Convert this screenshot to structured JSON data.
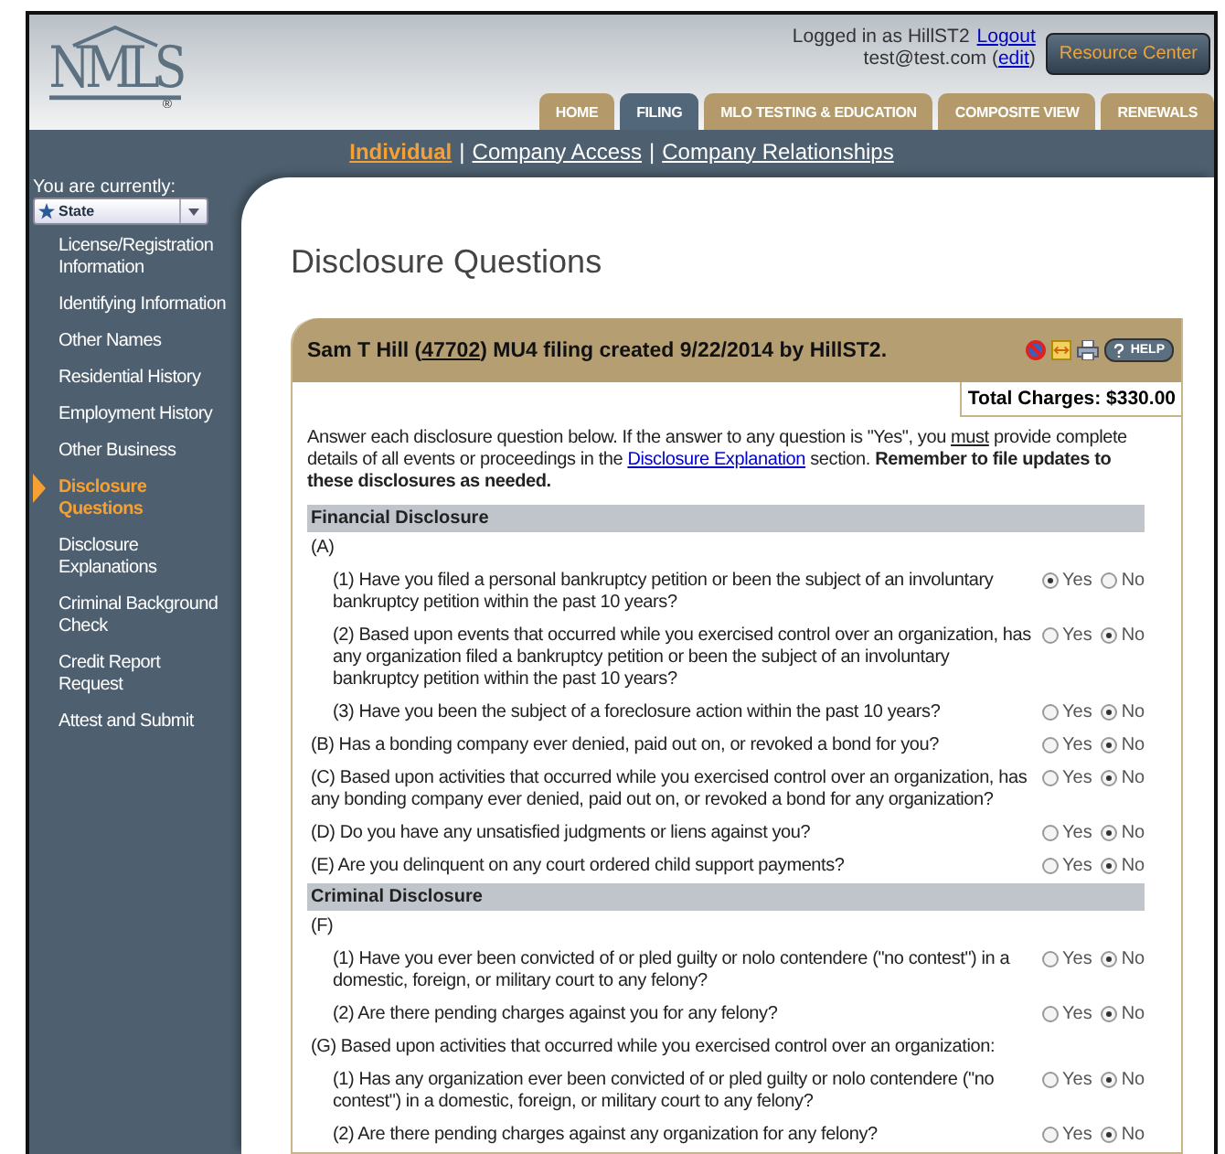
{
  "header": {
    "logo_text": "NMLS",
    "logo_mark": "®",
    "user_label": "Logged in as HillST2",
    "logout": "Logout",
    "email": "test@test.com (",
    "edit": "edit",
    "email_end": ")",
    "resource_button": "Resource Center"
  },
  "tabs": [
    {
      "label": "HOME",
      "selected": false
    },
    {
      "label": "FILING",
      "selected": true
    },
    {
      "label": "MLO TESTING & EDUCATION",
      "selected": false
    },
    {
      "label": "COMPOSITE VIEW",
      "selected": false
    },
    {
      "label": "RENEWALS",
      "selected": false
    }
  ],
  "subnav_separators": [
    "|",
    "|"
  ],
  "subnav": [
    {
      "label": "Individual",
      "selected": true
    },
    {
      "label": "Company Access",
      "selected": false
    },
    {
      "label": "Company Relationships",
      "selected": false
    }
  ],
  "sidebar": {
    "caption": "You are currently:",
    "role": "State",
    "items": [
      {
        "label": "License/Registration Information",
        "selected": false
      },
      {
        "label": "Identifying Information",
        "selected": false
      },
      {
        "label": "Other Names",
        "selected": false
      },
      {
        "label": "Residential History",
        "selected": false
      },
      {
        "label": "Employment History",
        "selected": false
      },
      {
        "label": "Other Business",
        "selected": false
      },
      {
        "label": "Disclosure Questions",
        "selected": true
      },
      {
        "label": "Disclosure Explanations",
        "selected": false
      },
      {
        "label": "Criminal Background Check",
        "selected": false
      },
      {
        "label": "Credit Report Request",
        "selected": false
      },
      {
        "label": "Attest and Submit",
        "selected": false
      }
    ]
  },
  "page_title": "Disclosure Questions",
  "filing": {
    "title_start": "Sam T Hill (",
    "title_id": "47702",
    "title_end": ") MU4 filing created 9/22/2014 by HillST2.",
    "help": "HELP",
    "total": "Total Charges: $330.00"
  },
  "intro": [
    {
      "kind": "plain",
      "text": "Answer each disclosure question below. If the answer to any question is \"Yes\", you "
    },
    {
      "kind": "underline",
      "text": "must"
    },
    {
      "kind": "plain",
      "text": " provide complete details of all events or proceedings in the "
    },
    {
      "kind": "link",
      "text": "Disclosure Explanation"
    },
    {
      "kind": "plain",
      "text": " section. "
    },
    {
      "kind": "bold",
      "text": "Remember to file updates to these disclosures as needed."
    }
  ],
  "sections": [
    {
      "title": "Financial Disclosure",
      "rows": [
        {
          "kind": "group",
          "text": "(A)"
        },
        {
          "kind": "sub",
          "text": "(1) Have you filed a personal bankruptcy petition or been the subject of an involuntary bankruptcy petition within the past 10 years?",
          "options": [
            {
              "label": "Yes",
              "selected": true
            },
            {
              "label": "No",
              "selected": false
            }
          ]
        },
        {
          "kind": "sub",
          "text": "(2) Based upon events that occurred while you exercised control over an organization, has any organization filed a bankruptcy petition or been the subject of an involuntary bankruptcy petition within the past 10 years?",
          "options": [
            {
              "label": "Yes",
              "selected": false
            },
            {
              "label": "No",
              "selected": true
            }
          ]
        },
        {
          "kind": "sub",
          "text": "(3) Have you been the subject of a foreclosure action within the past 10 years?",
          "options": [
            {
              "label": "Yes",
              "selected": false
            },
            {
              "label": "No",
              "selected": true
            }
          ]
        },
        {
          "kind": "question",
          "text": "(B) Has a bonding company ever denied, paid out on, or revoked a bond for you?",
          "options": [
            {
              "label": "Yes",
              "selected": false
            },
            {
              "label": "No",
              "selected": true
            }
          ]
        },
        {
          "kind": "question",
          "text": "(C) Based upon activities that occurred while you exercised control over an organization, has any bonding company ever denied, paid out on, or revoked a bond for any organization?",
          "options": [
            {
              "label": "Yes",
              "selected": false
            },
            {
              "label": "No",
              "selected": true
            }
          ]
        },
        {
          "kind": "question",
          "text": "(D) Do you have any unsatisfied judgments or liens against you?",
          "options": [
            {
              "label": "Yes",
              "selected": false
            },
            {
              "label": "No",
              "selected": true
            }
          ]
        },
        {
          "kind": "question",
          "text": "(E) Are you delinquent on any court ordered child support payments?",
          "options": [
            {
              "label": "Yes",
              "selected": false
            },
            {
              "label": "No",
              "selected": true
            }
          ]
        }
      ]
    },
    {
      "title": "Criminal Disclosure",
      "rows": [
        {
          "kind": "group",
          "text": "(F)"
        },
        {
          "kind": "sub",
          "text": "(1) Have you ever been convicted of or pled guilty or nolo contendere (\"no contest\") in a domestic, foreign, or military court to any felony?",
          "options": [
            {
              "label": "Yes",
              "selected": false
            },
            {
              "label": "No",
              "selected": true
            }
          ]
        },
        {
          "kind": "sub",
          "text": "(2) Are there pending charges against you for any felony?",
          "options": [
            {
              "label": "Yes",
              "selected": false
            },
            {
              "label": "No",
              "selected": true
            }
          ]
        },
        {
          "kind": "group",
          "text": "(G) Based upon activities that occurred while you exercised control over an organization:"
        },
        {
          "kind": "sub",
          "text": "(1) Has any organization ever been convicted of or pled guilty or nolo contendere (\"no contest\") in a domestic, foreign, or military court to any felony?",
          "options": [
            {
              "label": "Yes",
              "selected": false
            },
            {
              "label": "No",
              "selected": true
            }
          ]
        },
        {
          "kind": "sub",
          "text": "(2) Are there pending charges against any organization for any felony?",
          "options": [
            {
              "label": "Yes",
              "selected": false
            },
            {
              "label": "No",
              "selected": true
            }
          ]
        }
      ]
    }
  ]
}
